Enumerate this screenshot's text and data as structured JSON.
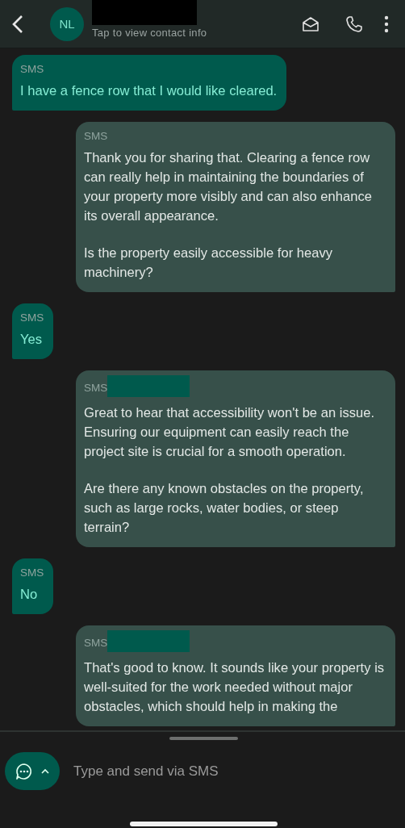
{
  "header": {
    "avatar_initials": "NL",
    "name_redacted": true,
    "subtitle": "Tap to view contact info"
  },
  "messages": [
    {
      "kind": "incoming",
      "label": "SMS",
      "label_redacted": false,
      "paragraphs": [
        "I have a fence row that I would like cleared."
      ]
    },
    {
      "kind": "outgoing",
      "label": "SMS",
      "label_redacted": false,
      "paragraphs": [
        "Thank you for sharing that. Clearing a fence row can really help in maintaining the boundaries of your property more visibly and can also enhance its overall appearance.",
        "Is the property easily accessible for heavy machinery?"
      ]
    },
    {
      "kind": "incoming",
      "label": "SMS",
      "label_redacted": false,
      "paragraphs": [
        "Yes"
      ]
    },
    {
      "kind": "outgoing",
      "label": "SMS",
      "label_redacted": true,
      "paragraphs": [
        "Great to hear that accessibility won't be an issue. Ensuring our equipment can easily reach the project site is crucial for a smooth operation.",
        "Are there any known obstacles on the property, such as large rocks, water bodies, or steep terrain?"
      ]
    },
    {
      "kind": "incoming",
      "label": "SMS",
      "label_redacted": false,
      "paragraphs": [
        "No"
      ]
    },
    {
      "kind": "outgoing",
      "label": "SMS",
      "label_redacted": true,
      "paragraphs": [
        "That's good to know. It sounds like your property is well-suited for the work needed without major obstacles, which should help in making the"
      ]
    }
  ],
  "composer": {
    "placeholder": "Type and send via SMS"
  }
}
